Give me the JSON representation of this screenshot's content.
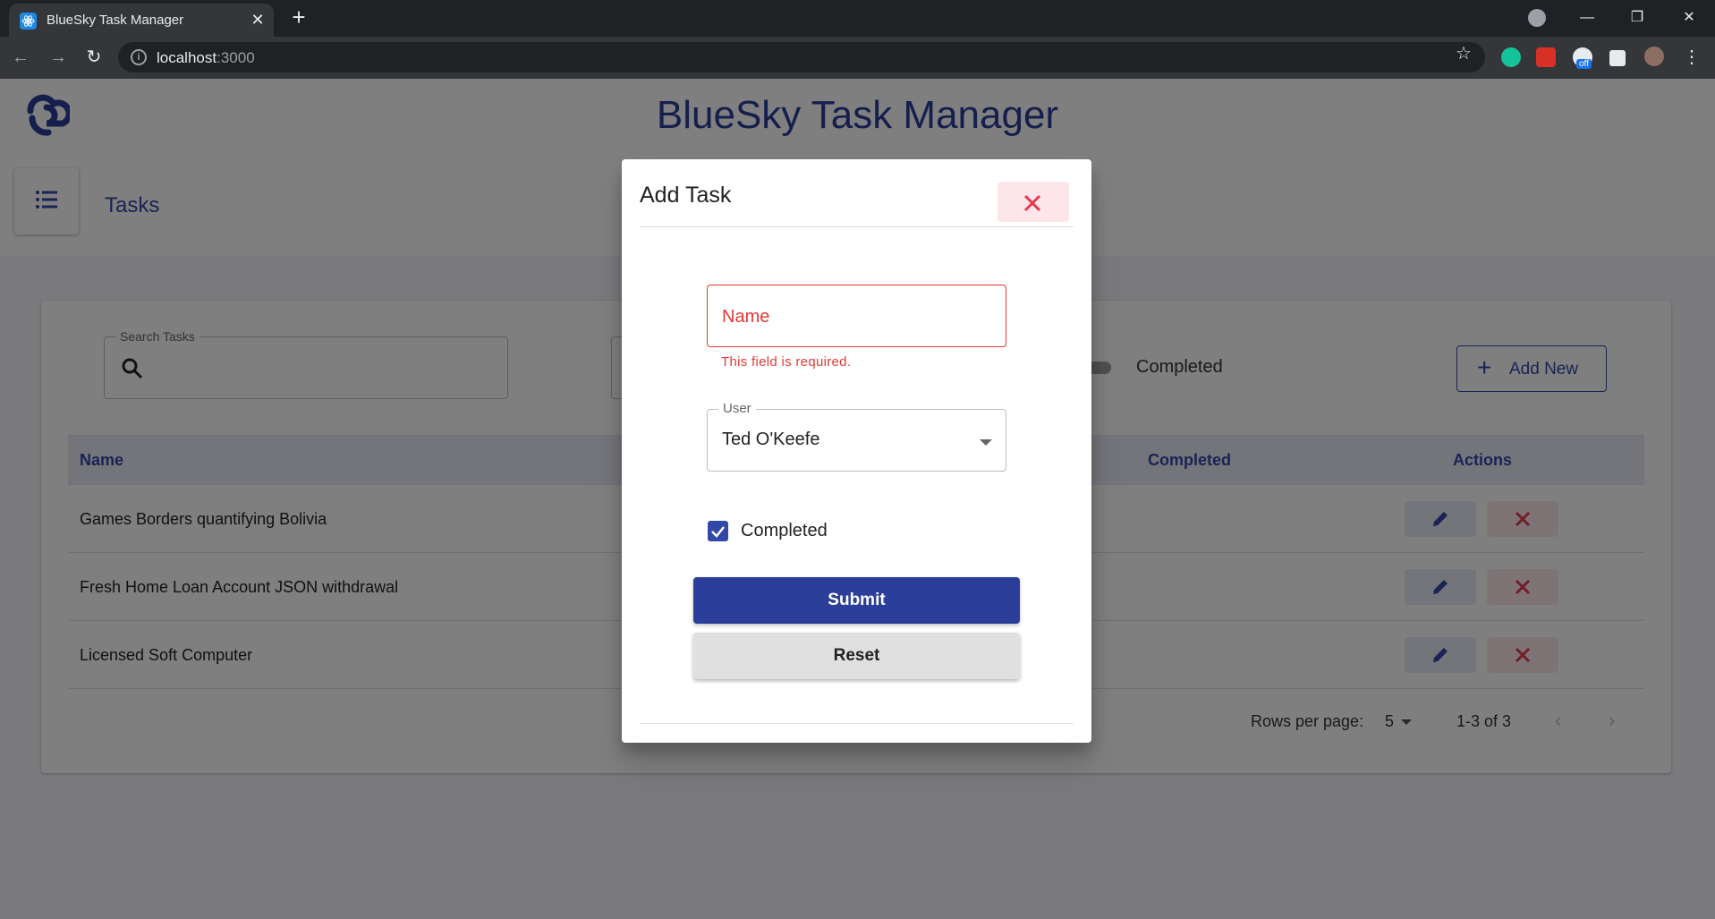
{
  "browser": {
    "tab_title": "BlueSky Task Manager",
    "url_host": "localhost",
    "url_port": ":3000",
    "ext_badge": "off"
  },
  "app": {
    "title": "BlueSky Task Manager",
    "page_title": "Tasks",
    "search_label": "Search Tasks",
    "completed_toggle_label": "Completed",
    "add_new_label": "Add New",
    "table": {
      "headers": {
        "name": "Name",
        "completed": "Completed",
        "actions": "Actions"
      },
      "rows": [
        {
          "name": "Games Borders quantifying Bolivia"
        },
        {
          "name": "Fresh Home Loan Account JSON withdrawal"
        },
        {
          "name": "Licensed Soft Computer"
        }
      ]
    },
    "pagination": {
      "rows_per_page_label": "Rows per page:",
      "rows_per_page_value": "5",
      "range": "1-3 of 3"
    }
  },
  "dialog": {
    "title": "Add Task",
    "name_placeholder": "Name",
    "name_error": "This field is required.",
    "user_label": "User",
    "user_value": "Ted O'Keefe",
    "completed_label": "Completed",
    "completed_checked": true,
    "submit_label": "Submit",
    "reset_label": "Reset"
  },
  "colors": {
    "brand": "#2b3f9a",
    "error": "#e53935",
    "delete_bg": "#fde6ea"
  }
}
